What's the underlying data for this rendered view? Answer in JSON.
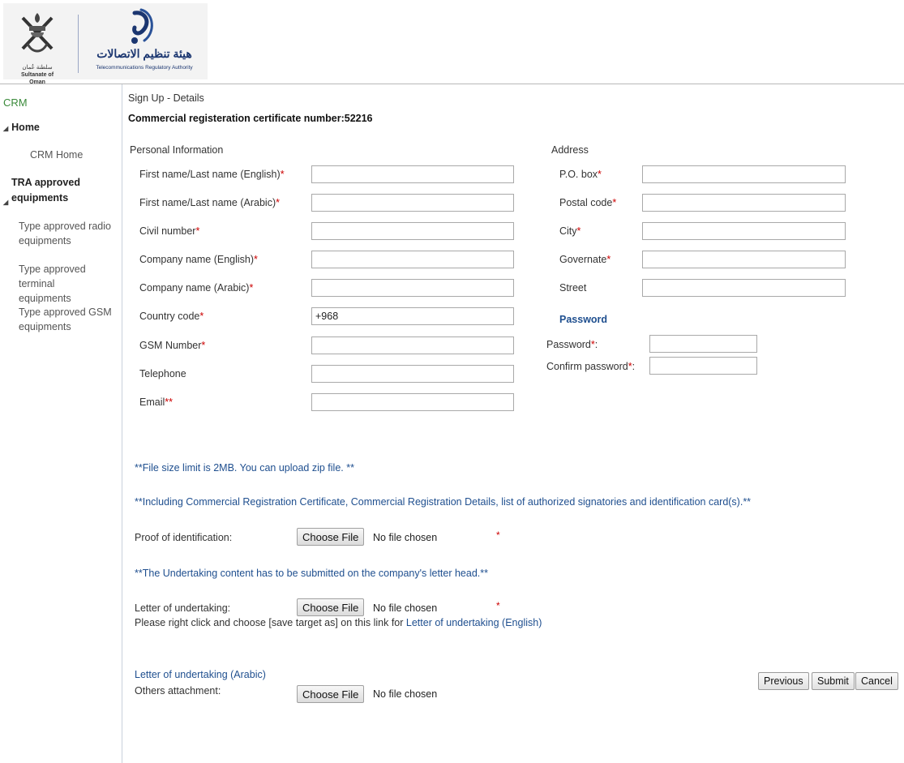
{
  "header": {
    "oman_label": "سلطنة عُمان",
    "oman_en": "Sultanate of Oman",
    "tra_ar": "هيئة تنظيم الاتصالات",
    "tra_en": "Telecommunications Regulatory Authority"
  },
  "sidebar": {
    "crm": "CRM",
    "home": "Home",
    "crm_home": "CRM Home",
    "tra_line1": "TRA approved",
    "tra_line2": "equipments",
    "items": [
      {
        "line1": "Type approved radio",
        "line2": "equipments"
      },
      {
        "line1": "Type approved terminal",
        "line2": "equipments"
      },
      {
        "line1": "Type approved GSM",
        "line2": "equipments"
      }
    ]
  },
  "main": {
    "breadcrumb": "Sign Up - Details",
    "reg_number": "Commercial registeration certificate number:52216",
    "personal_title": "Personal Information",
    "personal_fields": [
      {
        "label": "First name/Last name (English)",
        "req": "*",
        "value": ""
      },
      {
        "label": "First name/Last name (Arabic)",
        "req": "*",
        "value": ""
      },
      {
        "label": "Civil number",
        "req": "*",
        "value": ""
      },
      {
        "label": "Company name (English)",
        "req": "*",
        "value": ""
      },
      {
        "label": "Company name (Arabic)",
        "req": "*",
        "value": ""
      },
      {
        "label": "Country code",
        "req": "*",
        "value": "+968"
      },
      {
        "label": "GSM Number",
        "req": "*",
        "value": ""
      },
      {
        "label": "Telephone",
        "req": "",
        "value": ""
      },
      {
        "label": "Email",
        "req": "**",
        "value": ""
      }
    ],
    "address_title": "Address",
    "address_fields": [
      {
        "label": "P.O. box",
        "req": "*",
        "value": ""
      },
      {
        "label": "Postal code",
        "req": "*",
        "value": ""
      },
      {
        "label": "City",
        "req": "*",
        "value": ""
      },
      {
        "label": "Governate",
        "req": "*",
        "value": ""
      },
      {
        "label": "Street",
        "req": "",
        "value": ""
      }
    ],
    "password_title": "Password",
    "password_label": "Password",
    "confirm_label": "Confirm password",
    "pw_suffix": "*",
    "pw_colon": ":",
    "note_size": "**File size limit is 2MB. You can upload zip file. **",
    "note_including": "**Including Commercial Registration Certificate, Commercial Registration Details, list of authorized signatories and identification card(s).**",
    "proof_label": "Proof of identification:",
    "note_undertaking": "**The Undertaking content has to be submitted on the company's letter head.**",
    "letter_label": "Letter of undertaking:",
    "instruction": "Please right click and choose [save target as] on this link for ",
    "link_english": "Letter of undertaking (English)",
    "link_arabic": "Letter of undertaking (Arabic)",
    "others_label": "Others attachment:",
    "choose_file": "Choose File",
    "no_file": "No file chosen",
    "star": "*"
  },
  "buttons": {
    "previous": "Previous",
    "submit": "Submit",
    "cancel": "Cancel"
  },
  "colors": {
    "accent_blue": "#1f4f8f",
    "required_red": "#cc0000",
    "crm_green": "#3a8a3a"
  }
}
